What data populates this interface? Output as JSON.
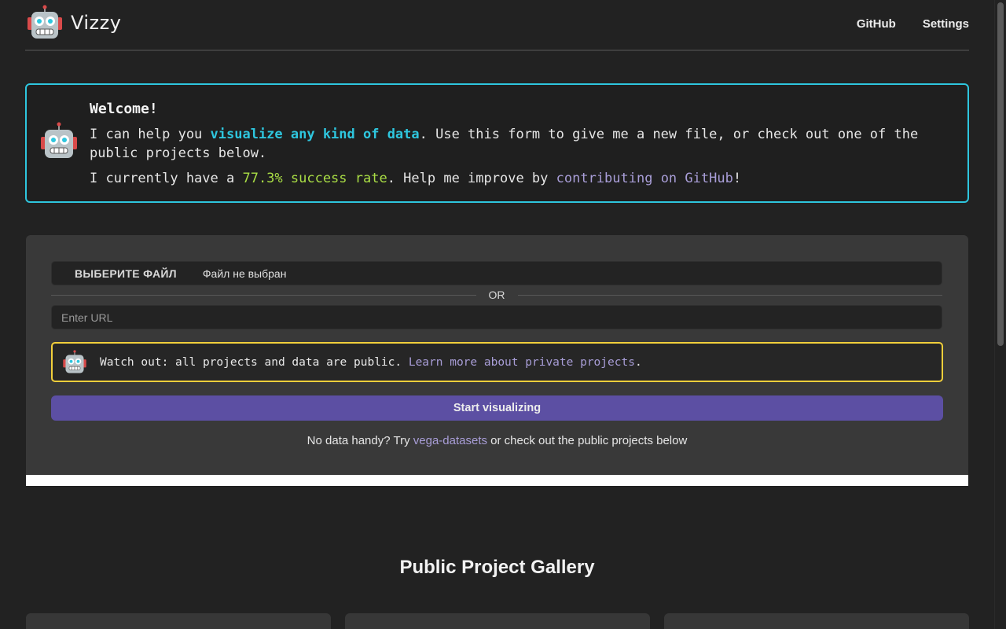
{
  "header": {
    "brand": "Vizzy",
    "nav": [
      {
        "label": "GitHub"
      },
      {
        "label": "Settings"
      }
    ]
  },
  "welcome": {
    "title": "Welcome!",
    "line1_prefix": "I can help you ",
    "line1_highlight": "visualize any kind of data",
    "line1_suffix": ". Use this form to give me a new file, or check out one of the public projects below.",
    "line2_prefix": "I currently have a ",
    "line2_rate": "77.3% success rate",
    "line2_middle": ". Help me improve by ",
    "line2_link": "contributing on GitHub",
    "line2_suffix": "!"
  },
  "form": {
    "file_button": "ВЫБЕРИТЕ ФАЙЛ",
    "file_status": "Файл не выбран",
    "or_text": "OR",
    "url_placeholder": "Enter URL",
    "warning_prefix": "Watch out: all projects and data are public. ",
    "warning_link": "Learn more about private projects",
    "warning_suffix": ".",
    "start_button": "Start visualizing",
    "nodata_prefix": "No data handy? Try ",
    "nodata_link": "vega-datasets",
    "nodata_suffix": " or check out the public projects below"
  },
  "gallery": {
    "title": "Public Project Gallery"
  },
  "colors": {
    "accent_cyan": "#2ec6de",
    "success_green": "#a9dd45",
    "link_purple": "#a99ed8",
    "warning_yellow": "#f2cf3b",
    "primary_button": "#5c4fa3"
  }
}
